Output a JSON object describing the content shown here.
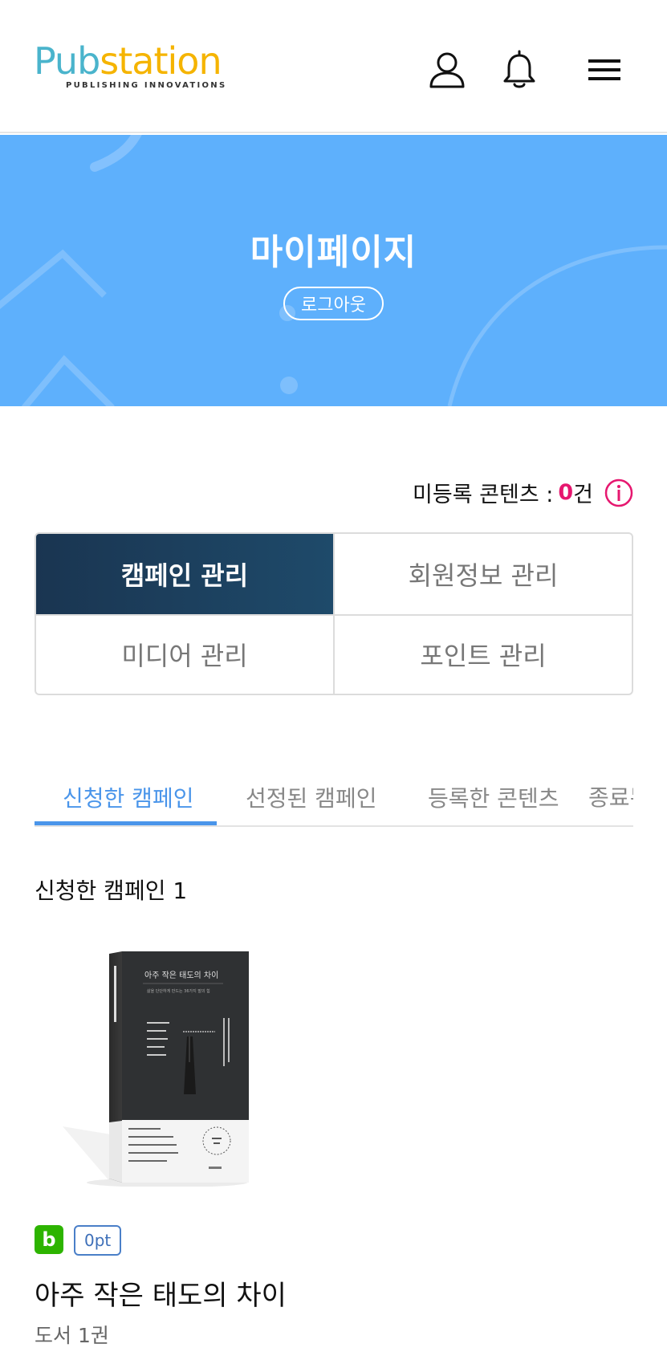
{
  "header": {
    "logo_pub": "Pub",
    "logo_station": "station",
    "logo_tagline": "PUBLISHING INNOVATIONS",
    "icons": [
      "user-icon",
      "bell-icon",
      "menu-icon"
    ]
  },
  "banner": {
    "title": "마이페이지",
    "logout_label": "로그아웃",
    "bg_color": "#5eb0fc"
  },
  "unregistered": {
    "label": "미등록 콘텐츠 :",
    "count": "0",
    "unit": "건",
    "icon": "info-icon",
    "count_color": "#e6176f"
  },
  "management": {
    "items": [
      {
        "label": "캠페인 관리",
        "active": true
      },
      {
        "label": "회원정보 관리",
        "active": false
      },
      {
        "label": "미디어 관리",
        "active": false
      },
      {
        "label": "포인트 관리",
        "active": false
      }
    ]
  },
  "tabs": {
    "items": [
      {
        "label": "신청한 캠페인",
        "active": true
      },
      {
        "label": "선정된 캠페인",
        "active": false
      },
      {
        "label": "등록한 콘텐츠",
        "active": false
      },
      {
        "label": "종료된 캠페인",
        "active": false
      }
    ],
    "accent_color": "#4a95ea"
  },
  "section": {
    "title": "신청한 캠페인 1"
  },
  "campaign": {
    "platform_badge": "b",
    "points_badge": "0pt",
    "title": "아주 작은 태도의 차이",
    "subtitle": "도서 1권",
    "cover": {
      "title": "아주 작은 태도의 차이",
      "tagline": "삶을 단단하게 만드는 36가지 말의 힘"
    }
  }
}
